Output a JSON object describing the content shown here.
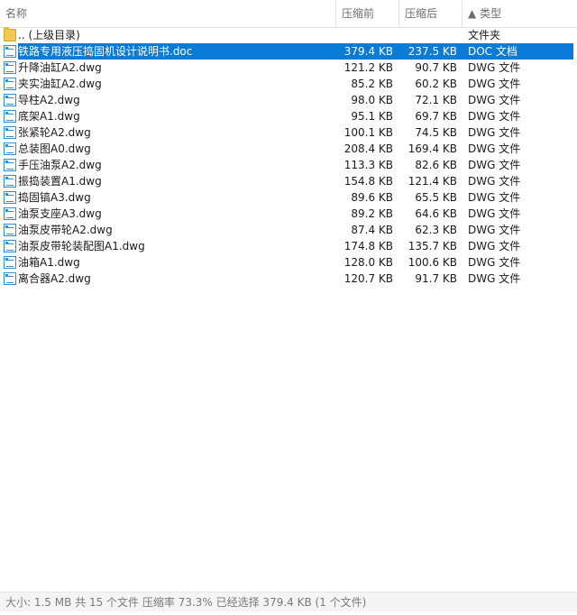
{
  "columns": {
    "name": "名称",
    "size": "压缩前",
    "packed": "压缩后",
    "sort_indicator": "▲",
    "type": "类型"
  },
  "parent_row": {
    "name": ".. (上级目录)",
    "type": "文件夹",
    "icon": "folder-icon"
  },
  "files": [
    {
      "name": "铁路专用液压捣固机设计说明书.doc",
      "size": "379.4 KB",
      "packed": "237.5 KB",
      "type": "DOC 文档",
      "selected": true
    },
    {
      "name": "升降油缸A2.dwg",
      "size": "121.2 KB",
      "packed": "90.7 KB",
      "type": "DWG 文件"
    },
    {
      "name": "夹实油缸A2.dwg",
      "size": "85.2 KB",
      "packed": "60.2 KB",
      "type": "DWG 文件"
    },
    {
      "name": "导柱A2.dwg",
      "size": "98.0 KB",
      "packed": "72.1 KB",
      "type": "DWG 文件"
    },
    {
      "name": "底架A1.dwg",
      "size": "95.1 KB",
      "packed": "69.7 KB",
      "type": "DWG 文件"
    },
    {
      "name": "张紧轮A2.dwg",
      "size": "100.1 KB",
      "packed": "74.5 KB",
      "type": "DWG 文件"
    },
    {
      "name": "总装图A0.dwg",
      "size": "208.4 KB",
      "packed": "169.4 KB",
      "type": "DWG 文件"
    },
    {
      "name": "手压油泵A2.dwg",
      "size": "113.3 KB",
      "packed": "82.6 KB",
      "type": "DWG 文件"
    },
    {
      "name": "振捣装置A1.dwg",
      "size": "154.8 KB",
      "packed": "121.4 KB",
      "type": "DWG 文件"
    },
    {
      "name": "捣固镐A3.dwg",
      "size": "89.6 KB",
      "packed": "65.5 KB",
      "type": "DWG 文件"
    },
    {
      "name": "油泵支座A3.dwg",
      "size": "89.2 KB",
      "packed": "64.6 KB",
      "type": "DWG 文件"
    },
    {
      "name": "油泵皮带轮A2.dwg",
      "size": "87.4 KB",
      "packed": "62.3 KB",
      "type": "DWG 文件"
    },
    {
      "name": "油泵皮带轮装配图A1.dwg",
      "size": "174.8 KB",
      "packed": "135.7 KB",
      "type": "DWG 文件"
    },
    {
      "name": "油箱A1.dwg",
      "size": "128.0 KB",
      "packed": "100.6 KB",
      "type": "DWG 文件"
    },
    {
      "name": "离合器A2.dwg",
      "size": "120.7 KB",
      "packed": "91.7 KB",
      "type": "DWG 文件"
    }
  ],
  "status_bar": "大小: 1.5 MB 共 15 个文件 压缩率 73.3% 已经选择 379.4 KB (1 个文件)"
}
